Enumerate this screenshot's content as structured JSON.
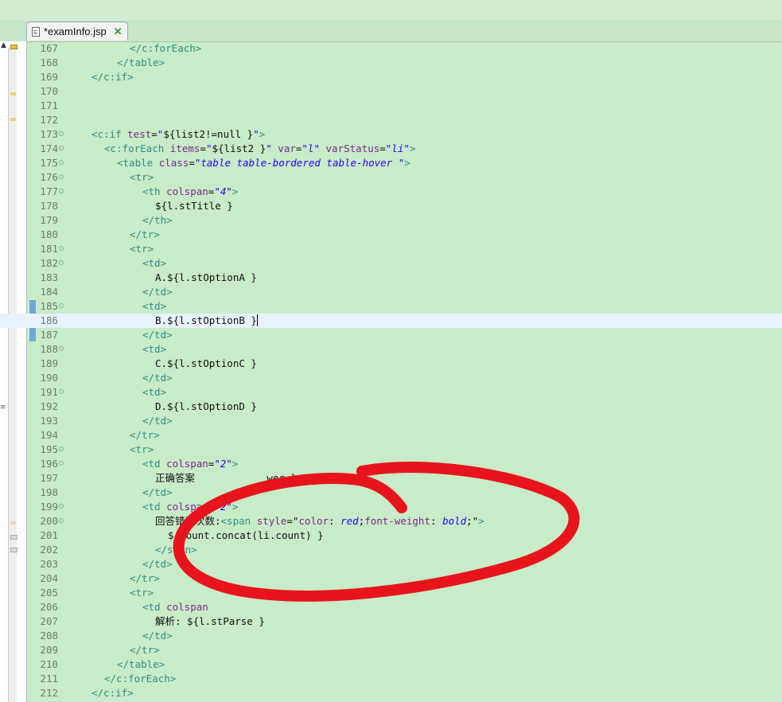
{
  "editor": {
    "tab": {
      "title": "*examInfo.jsp",
      "close_symbol": "✕"
    },
    "current_line": 186,
    "lines": [
      {
        "no": "167",
        "indent": 10,
        "parts": [
          [
            "tg",
            "</c:forEach>"
          ]
        ]
      },
      {
        "no": "168",
        "indent": 8,
        "parts": [
          [
            "tg",
            "</table>"
          ]
        ]
      },
      {
        "no": "169",
        "indent": 4,
        "parts": [
          [
            "tg",
            "</c:if>"
          ]
        ]
      },
      {
        "no": "170",
        "indent": 0,
        "parts": []
      },
      {
        "no": "171",
        "indent": 0,
        "parts": []
      },
      {
        "no": "172",
        "indent": 0,
        "parts": []
      },
      {
        "no": "173",
        "indent": 4,
        "fold": true,
        "parts": [
          [
            "tg",
            "<c:if "
          ],
          [
            "at",
            "test"
          ],
          [
            "tx",
            "="
          ],
          [
            "vl",
            "\""
          ],
          [
            "tx",
            "${list2!=null }"
          ],
          [
            "vl",
            "\""
          ],
          [
            "tg",
            ">"
          ]
        ]
      },
      {
        "no": "174",
        "indent": 6,
        "fold": true,
        "parts": [
          [
            "tg",
            "<c:forEach "
          ],
          [
            "at",
            "items"
          ],
          [
            "tx",
            "="
          ],
          [
            "vl",
            "\""
          ],
          [
            "tx",
            "${list2 }"
          ],
          [
            "vl",
            "\""
          ],
          [
            "tx",
            " "
          ],
          [
            "at",
            "var"
          ],
          [
            "tx",
            "="
          ],
          [
            "vl",
            "\"l\""
          ],
          [
            "tx",
            " "
          ],
          [
            "at",
            "varStatus"
          ],
          [
            "tx",
            "="
          ],
          [
            "vl",
            "\"li\""
          ],
          [
            "tg",
            ">"
          ]
        ]
      },
      {
        "no": "175",
        "indent": 8,
        "fold": true,
        "parts": [
          [
            "tg",
            "<table "
          ],
          [
            "at",
            "class"
          ],
          [
            "tx",
            "="
          ],
          [
            "vl",
            "\"table table-bordered table-hover \""
          ],
          [
            "tg",
            ">"
          ]
        ]
      },
      {
        "no": "176",
        "indent": 10,
        "fold": true,
        "parts": [
          [
            "tg",
            "<tr>"
          ]
        ]
      },
      {
        "no": "177",
        "indent": 12,
        "fold": true,
        "parts": [
          [
            "tg",
            "<th "
          ],
          [
            "at",
            "colspan"
          ],
          [
            "tx",
            "="
          ],
          [
            "vl",
            "\"4\""
          ],
          [
            "tg",
            ">"
          ]
        ]
      },
      {
        "no": "178",
        "indent": 14,
        "parts": [
          [
            "tx",
            "${l.stTitle }"
          ]
        ]
      },
      {
        "no": "179",
        "indent": 12,
        "parts": [
          [
            "tg",
            "</th>"
          ]
        ]
      },
      {
        "no": "180",
        "indent": 10,
        "parts": [
          [
            "tg",
            "</tr>"
          ]
        ]
      },
      {
        "no": "181",
        "indent": 10,
        "fold": true,
        "parts": [
          [
            "tg",
            "<tr>"
          ]
        ]
      },
      {
        "no": "182",
        "indent": 12,
        "fold": true,
        "parts": [
          [
            "tg",
            "<td>"
          ]
        ]
      },
      {
        "no": "183",
        "indent": 14,
        "parts": [
          [
            "tx",
            "A.${l.stOptionA }"
          ]
        ]
      },
      {
        "no": "184",
        "indent": 12,
        "parts": [
          [
            "tg",
            "</td>"
          ]
        ]
      },
      {
        "no": "185",
        "indent": 12,
        "fold": true,
        "parts": [
          [
            "tg",
            "<td>"
          ]
        ]
      },
      {
        "no": "186",
        "indent": 14,
        "parts": [
          [
            "tx",
            "B.${l.stOptionB }"
          ]
        ],
        "caret": true
      },
      {
        "no": "187",
        "indent": 12,
        "parts": [
          [
            "tg",
            "</td>"
          ]
        ]
      },
      {
        "no": "188",
        "indent": 12,
        "fold": true,
        "parts": [
          [
            "tg",
            "<td>"
          ]
        ]
      },
      {
        "no": "189",
        "indent": 14,
        "parts": [
          [
            "tx",
            "C.${l.stOptionC }"
          ]
        ]
      },
      {
        "no": "190",
        "indent": 12,
        "parts": [
          [
            "tg",
            "</td>"
          ]
        ]
      },
      {
        "no": "191",
        "indent": 12,
        "fold": true,
        "parts": [
          [
            "tg",
            "<td>"
          ]
        ]
      },
      {
        "no": "192",
        "indent": 14,
        "parts": [
          [
            "tx",
            "D.${l.stOptionD }"
          ]
        ]
      },
      {
        "no": "193",
        "indent": 12,
        "parts": [
          [
            "tg",
            "</td>"
          ]
        ]
      },
      {
        "no": "194",
        "indent": 10,
        "parts": [
          [
            "tg",
            "</tr>"
          ]
        ]
      },
      {
        "no": "195",
        "indent": 10,
        "fold": true,
        "parts": [
          [
            "tg",
            "<tr>"
          ]
        ]
      },
      {
        "no": "196",
        "indent": 12,
        "fold": true,
        "parts": [
          [
            "tg",
            "<td "
          ],
          [
            "at",
            "colspan"
          ],
          [
            "tx",
            "="
          ],
          [
            "vl",
            "\"2\""
          ],
          [
            "tg",
            ">"
          ]
        ]
      },
      {
        "no": "197",
        "indent": 14,
        "parts": [
          [
            "tx",
            "正确答案            wer }"
          ]
        ]
      },
      {
        "no": "198",
        "indent": 12,
        "parts": [
          [
            "tg",
            "</td>"
          ]
        ]
      },
      {
        "no": "199",
        "indent": 12,
        "fold": true,
        "parts": [
          [
            "tg",
            "<td "
          ],
          [
            "at",
            "colspan"
          ],
          [
            "tx",
            "="
          ],
          [
            "vl",
            "\"2\""
          ],
          [
            "tg",
            ">"
          ]
        ]
      },
      {
        "no": "200",
        "indent": 14,
        "fold": true,
        "parts": [
          [
            "tx",
            "回答错误次数:"
          ],
          [
            "tg",
            "<span "
          ],
          [
            "at",
            "style"
          ],
          [
            "tx",
            "=\""
          ],
          [
            "at",
            "color"
          ],
          [
            "tx",
            ": "
          ],
          [
            "vl",
            "red"
          ],
          [
            "tx",
            ";"
          ],
          [
            "at",
            "font-weight"
          ],
          [
            "tx",
            ": "
          ],
          [
            "vl",
            "bold"
          ],
          [
            "tx",
            ";\""
          ],
          [
            "tg",
            ">"
          ]
        ]
      },
      {
        "no": "201",
        "indent": 16,
        "parts": [
          [
            "tx",
            "${count.concat(li.count) }"
          ]
        ]
      },
      {
        "no": "202",
        "indent": 14,
        "parts": [
          [
            "tg",
            "</span>"
          ]
        ]
      },
      {
        "no": "203",
        "indent": 12,
        "parts": [
          [
            "tg",
            "</td>"
          ]
        ]
      },
      {
        "no": "204",
        "indent": 10,
        "parts": [
          [
            "tg",
            "</tr>"
          ]
        ]
      },
      {
        "no": "205",
        "indent": 10,
        "parts": [
          [
            "tg",
            "<tr>"
          ]
        ]
      },
      {
        "no": "206",
        "indent": 12,
        "parts": [
          [
            "tg",
            "<td "
          ],
          [
            "at",
            "colspan"
          ]
        ]
      },
      {
        "no": "207",
        "indent": 14,
        "parts": [
          [
            "tx",
            "解析: ${l.stParse }"
          ]
        ]
      },
      {
        "no": "208",
        "indent": 12,
        "parts": [
          [
            "tg",
            "</td>"
          ]
        ]
      },
      {
        "no": "209",
        "indent": 10,
        "parts": [
          [
            "tg",
            "</tr>"
          ]
        ]
      },
      {
        "no": "210",
        "indent": 8,
        "parts": [
          [
            "tg",
            "</table>"
          ]
        ]
      },
      {
        "no": "211",
        "indent": 6,
        "parts": [
          [
            "tg",
            "</c:forEach>"
          ]
        ]
      },
      {
        "no": "212",
        "indent": 4,
        "parts": [
          [
            "tg",
            "</c:if>"
          ]
        ]
      }
    ]
  },
  "colors": {
    "background": "#c8ebc8",
    "tag": "#2f8d8d",
    "attribute": "#7a2a8a",
    "value": "#2a00ff",
    "annotation": "#e8141c"
  }
}
